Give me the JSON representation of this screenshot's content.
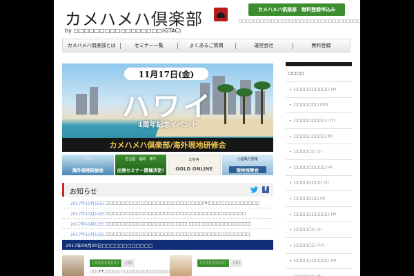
{
  "header": {
    "site_title": "カメハメハ倶楽部",
    "byline": "by □□□□□□□□□□□□□□□□□(GTAC)",
    "register_button": "カメハメハ倶楽部　無料登録申込み",
    "description": "□□□□□□□□□□□□□□□□□□□□□□□□□□□□□□□□□□□□□□□□□□□□□□□□□□□□□□□□□□□□□□□□□"
  },
  "nav": {
    "items": [
      {
        "label": "カメハメハ倶楽部とは"
      },
      {
        "label": "セミナー一覧"
      },
      {
        "label": "よくあるご質問"
      },
      {
        "label": "運営会社"
      },
      {
        "label": "無料登録"
      }
    ]
  },
  "banner": {
    "date": "11月17日(金)",
    "headline": "ハワイ",
    "subtitle": "4周年記念イベント",
    "footer": "カメハメハ倶楽部/海外現地研修会"
  },
  "promos": [
    {
      "sub": "ハワイ",
      "main": "海外現地研修会"
    },
    {
      "sub": "名古屋　福岡　神戸",
      "main": "出張セミナー開催決定!"
    },
    {
      "sub": "幻冬舎",
      "main": "GOLD ONLINE"
    },
    {
      "sub": "小型風力発電",
      "main": "現地視察会"
    }
  ],
  "news": {
    "title": "お知らせ",
    "items": [
      {
        "date": "2017年10月15日",
        "text": "□□□□□□□□□□□□□□□□□□□□□□□□□(5)□□□□□□□□□□□□□"
      },
      {
        "date": "2017年10月14日",
        "text": "□□□□□□□□□□□□□□□□□□□□□□□□□□□□□□□□□□□□"
      },
      {
        "date": "2017年10月13日",
        "text": "□□□□□□□□□□□□□□□□□□□□□ □□□□□□□□□□□□□□□□"
      },
      {
        "date": "2017年10月12日",
        "text": "□□□□□□□□□□□□□□□□□□□□□□□□□□□□□□□□□□□□□"
      }
    ]
  },
  "feature": {
    "heading": "2017年09月20日□□□□□□□□□□□□",
    "cards": [
      {
        "tag": "□□□□□□□□",
        "tag2": "□□",
        "text": "□□□FT□□□□□ □□□□□□□□□□□□□□□□□□□□"
      },
      {
        "tag": "□□□□□□□□",
        "tag2": "□□",
        "text": ""
      }
    ]
  },
  "sidebar": {
    "title": "□□□□",
    "items": [
      {
        "label": "□□□□□□□□□□",
        "count": "(4)"
      },
      {
        "label": "□□□□□□□",
        "count": "(10)"
      },
      {
        "label": "□□□□□□□□□",
        "count": "(17)"
      },
      {
        "label": "□□□□□□□□□",
        "count": "(6)"
      },
      {
        "label": "□□□□□□",
        "count": "(2)"
      },
      {
        "label": "□□□□□□□□□",
        "count": "(4)"
      },
      {
        "label": "□□□□□□□□",
        "count": "(5)"
      },
      {
        "label": "□□□□□□□",
        "count": "(2)"
      },
      {
        "label": "□□□□□□□□□□",
        "count": "(4)"
      },
      {
        "label": "□□□□□□",
        "count": "(2)"
      },
      {
        "label": "□□□□□□",
        "count": "(12)"
      },
      {
        "label": "□□□□□□□□□□",
        "count": "(0)"
      },
      {
        "label": "□□□□□□",
        "count": "(0)"
      }
    ]
  },
  "colors": {
    "page_background": "#000000",
    "register_button": "#3d8e2f",
    "news_accent": "#c62828",
    "feature_bar": "#0f2e75",
    "banner_footer_text": "#f2c84b"
  },
  "icons": [
    "turtle-emblem-icon",
    "twitter-icon",
    "facebook-icon"
  ]
}
